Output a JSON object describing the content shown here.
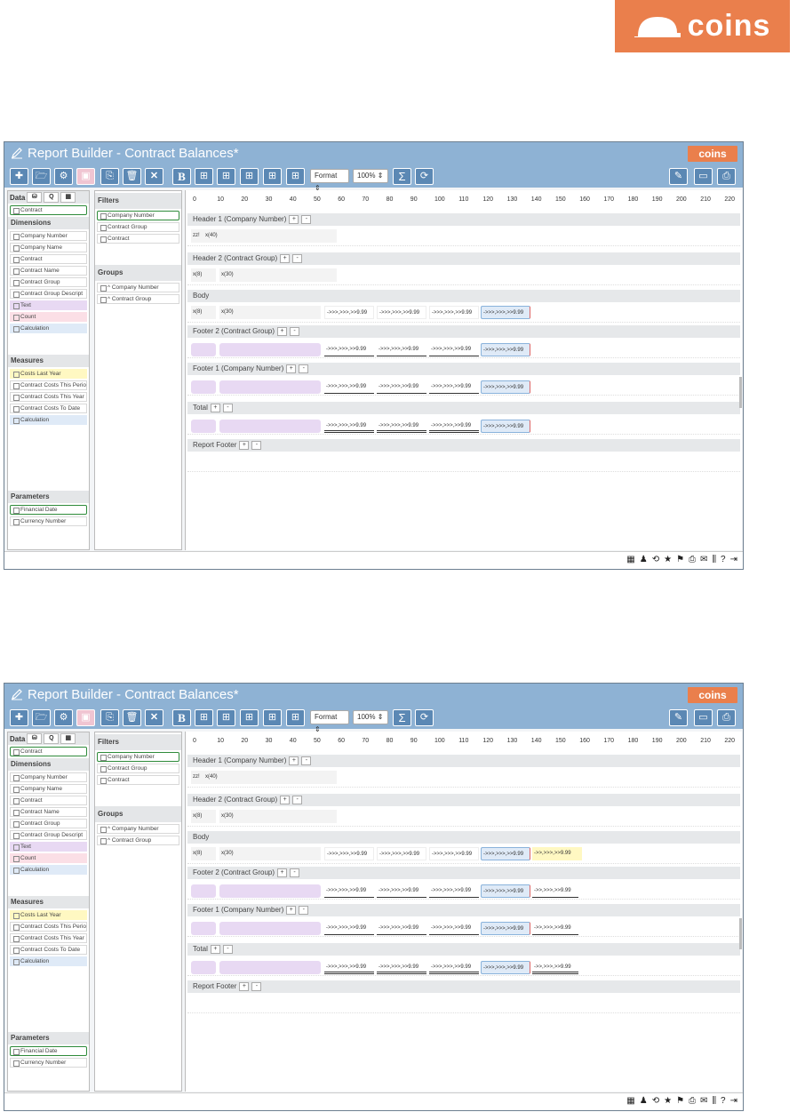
{
  "brand": {
    "logo_text": "coins",
    "small_logo_text": "coins"
  },
  "app": {
    "title": "Report Builder  -  Contract Balances*"
  },
  "toolbar": {
    "format_label": "Format",
    "zoom_label": "100%",
    "bold_label": "B",
    "sum_label": "Σ"
  },
  "left": {
    "data_label": "Data",
    "contract_chip": "Contract",
    "dimensions_label": "Dimensions",
    "dimensions": [
      "Company Number",
      "Company Name",
      "Contract",
      "Contract Name",
      "Contract Group",
      "Contract Group Descript"
    ],
    "text_item": "Text",
    "count_item": "Count",
    "calc_item": "Calculation",
    "measures_label": "Measures",
    "measures": [
      "Costs Last Year",
      "Contract Costs This Perio",
      "Contract Costs This Year",
      "Contract Costs To Date"
    ],
    "measure_calc": "Calculation",
    "parameters_label": "Parameters",
    "parameters": [
      "Financial Date",
      "Currency Number"
    ]
  },
  "mid": {
    "filters_label": "Filters",
    "filters": [
      "Company Number",
      "Contract Group",
      "Contract"
    ],
    "groups_label": "Groups",
    "groups": [
      "^ Company Number",
      "^ Contract Group"
    ]
  },
  "ruler": [
    "0",
    "10",
    "20",
    "30",
    "40",
    "50",
    "60",
    "70",
    "80",
    "90",
    "100",
    "110",
    "120",
    "130",
    "140",
    "150",
    "160",
    "170",
    "180",
    "190",
    "200",
    "210",
    "220"
  ],
  "bands": {
    "h1": "Header 1 (Company Number)",
    "h2": "Header 2 (Contract Group)",
    "body": "Body",
    "f2": "Footer 2 (Contract Group)",
    "f1": "Footer 1 (Company Number)",
    "total": "Total",
    "rf": "Report Footer",
    "plus": "+",
    "minus": "-"
  },
  "fields": {
    "zz": "zz!",
    "x40": "x(40)",
    "x8": "x(8)",
    "x30": "x(30)",
    "num": "->>>,>>>,>>9.99",
    "num2": "->>,>>>,>>9.99",
    "numshort": "->>,>>>,>>9.99"
  }
}
